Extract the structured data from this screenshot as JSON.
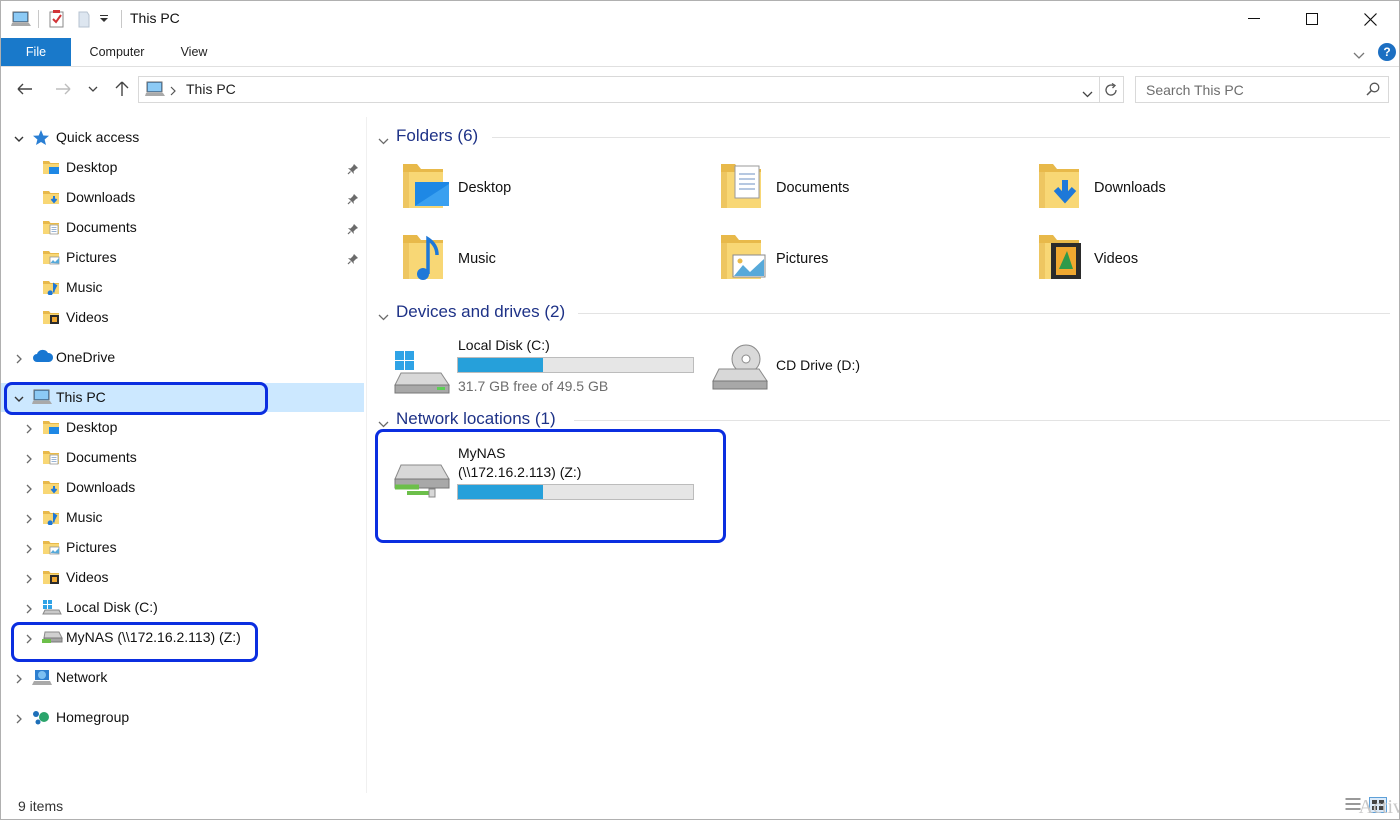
{
  "window": {
    "title": "This PC"
  },
  "ribbon": {
    "tabs": [
      "File",
      "Computer",
      "View"
    ],
    "help": "?"
  },
  "address": {
    "path": "This PC",
    "search_placeholder": "Search This PC"
  },
  "nav": {
    "quick_access": {
      "label": "Quick access",
      "items": [
        {
          "label": "Desktop",
          "pinned": true
        },
        {
          "label": "Downloads",
          "pinned": true
        },
        {
          "label": "Documents",
          "pinned": true
        },
        {
          "label": "Pictures",
          "pinned": true
        },
        {
          "label": "Music",
          "pinned": false
        },
        {
          "label": "Videos",
          "pinned": false
        }
      ]
    },
    "onedrive": "OneDrive",
    "this_pc": {
      "label": "This PC",
      "items": [
        "Desktop",
        "Documents",
        "Downloads",
        "Music",
        "Pictures",
        "Videos",
        "Local Disk (C:)",
        "MyNAS (\\\\172.16.2.113) (Z:)"
      ]
    },
    "network": "Network",
    "homegroup": "Homegroup"
  },
  "content": {
    "folders_header": "Folders (6)",
    "folders": [
      "Desktop",
      "Documents",
      "Downloads",
      "Music",
      "Pictures",
      "Videos"
    ],
    "drives_header": "Devices and drives (2)",
    "local_disk": {
      "label": "Local Disk (C:)",
      "free_text": "31.7 GB free of 49.5 GB",
      "used_fraction": 0.36
    },
    "cd_drive": {
      "label": "CD Drive (D:)"
    },
    "network_header": "Network locations (1)",
    "nas": {
      "name": "MyNAS",
      "address": "(\\\\172.16.2.113) (Z:)",
      "used_fraction": 0.36
    }
  },
  "status": {
    "items": "9 items",
    "watermark": "Activ"
  },
  "colors": {
    "accent": "#1979ca",
    "selection": "#cce8ff",
    "highlight_box": "#0b2ee0",
    "bar_fill": "#26a0da",
    "group_header": "#1e3287"
  }
}
